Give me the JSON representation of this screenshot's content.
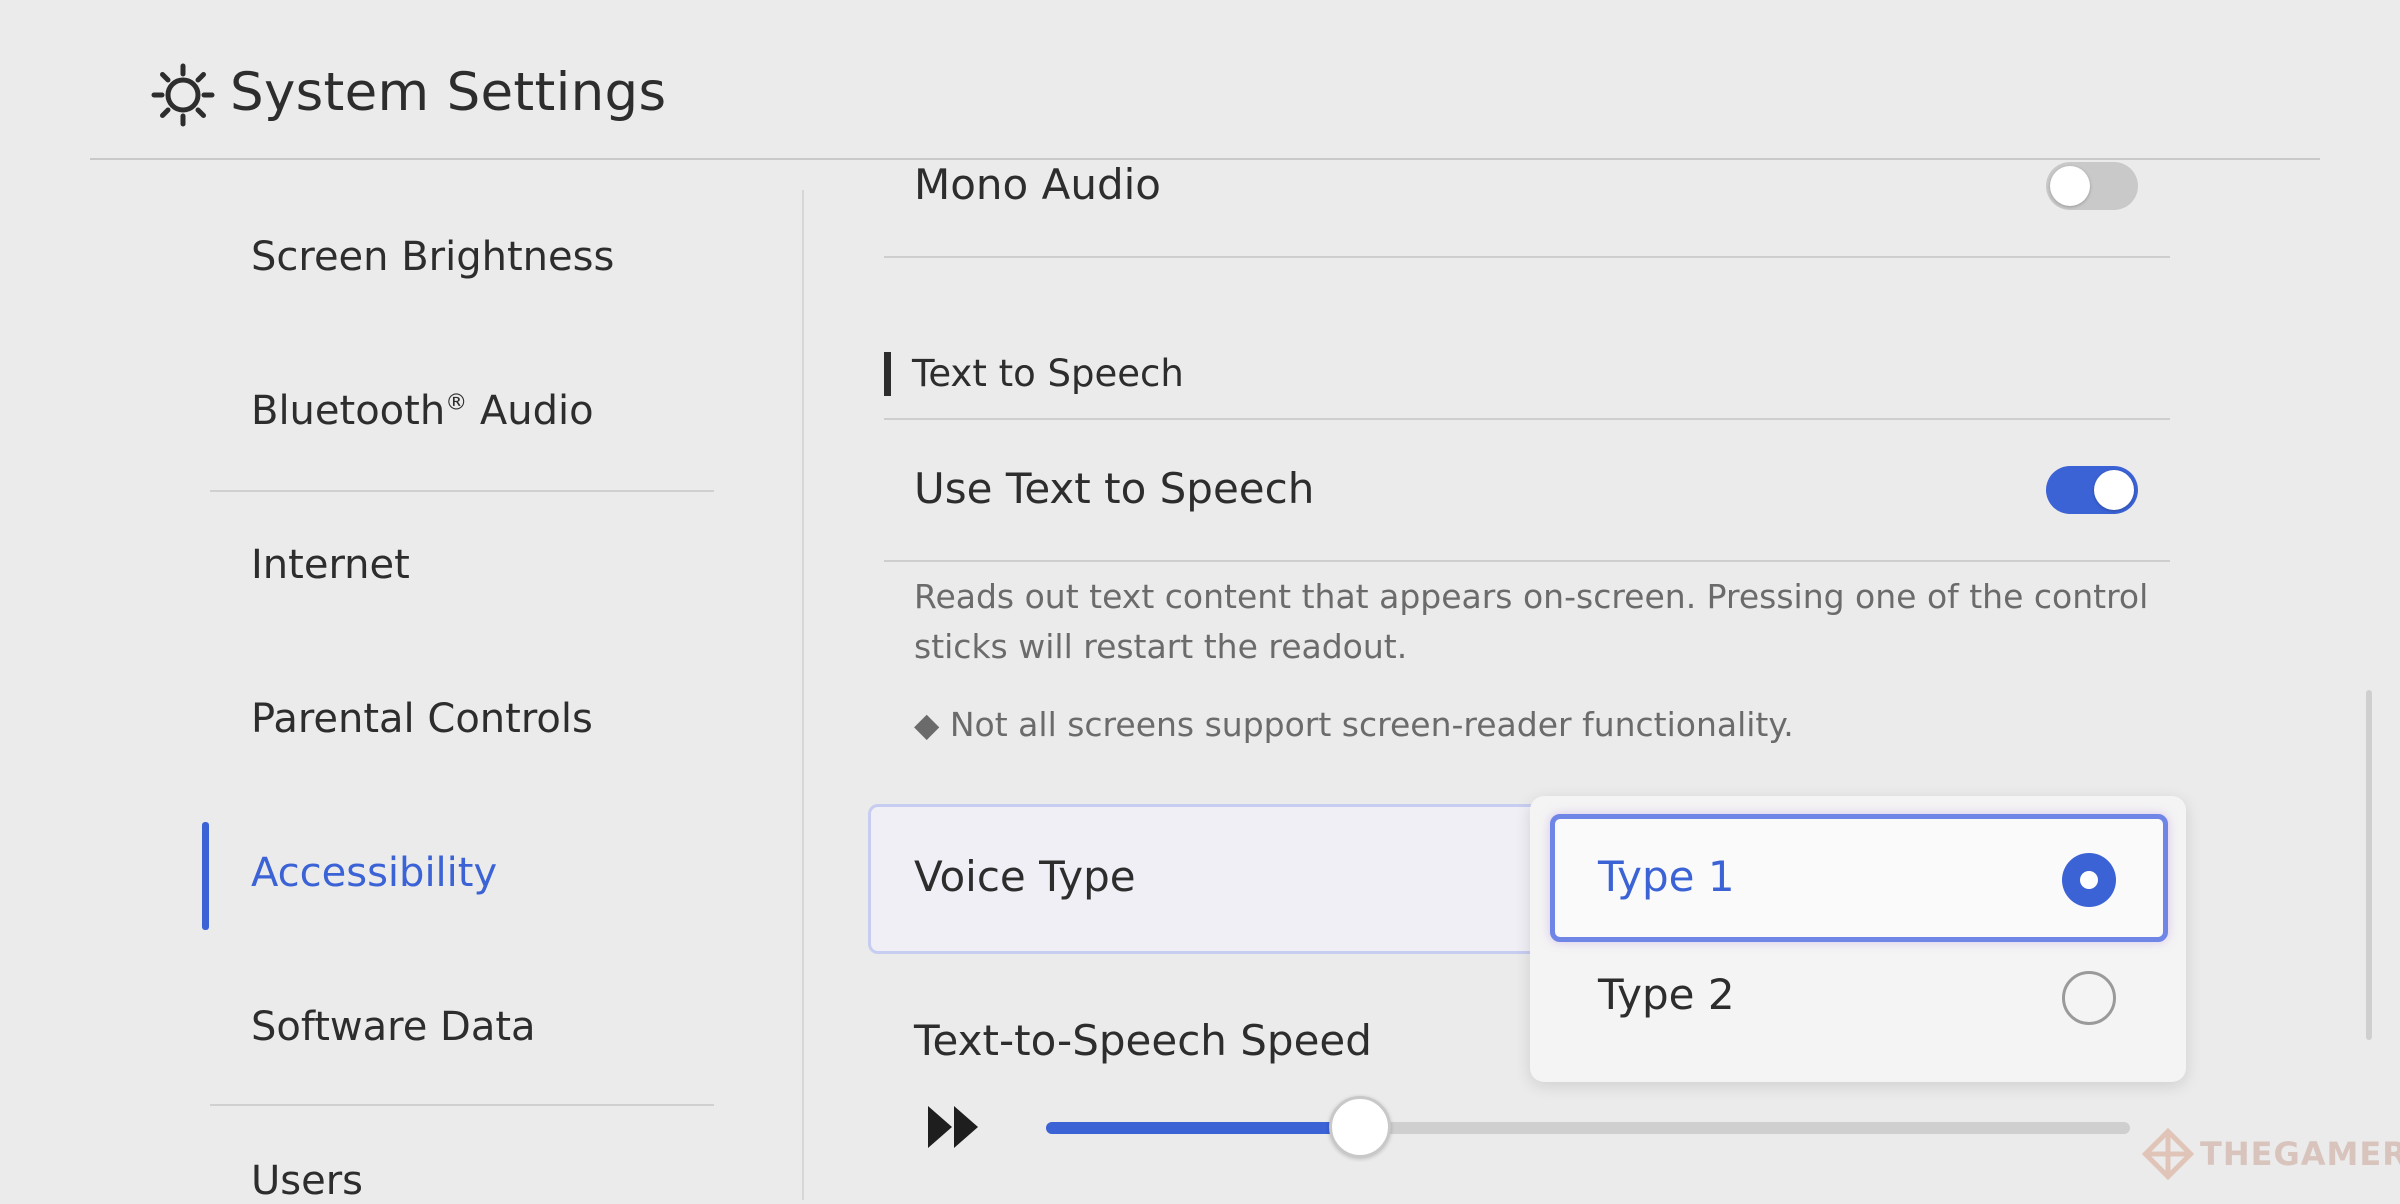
{
  "header": {
    "title": "System Settings",
    "icon": "gear-icon"
  },
  "sidebar": {
    "items": [
      {
        "label": "Screen Brightness"
      },
      {
        "label": "Bluetooth",
        "suffix": "Audio",
        "reg": "®"
      },
      {
        "label": "Internet"
      },
      {
        "label": "Parental Controls"
      },
      {
        "label": "Accessibility",
        "active": true
      },
      {
        "label": "Software Data"
      },
      {
        "label": "Users"
      }
    ]
  },
  "main": {
    "mono_audio": {
      "label": "Mono Audio",
      "enabled": false
    },
    "tts_section": {
      "title": "Text to Speech"
    },
    "use_tts": {
      "label": "Use Text to Speech",
      "enabled": true,
      "description": "Reads out text content that appears on-screen. Pressing one of the control sticks will restart the readout.",
      "note": "◆ Not all screens support screen-reader functionality."
    },
    "voice_type": {
      "label": "Voice Type",
      "options": [
        {
          "label": "Type 1",
          "selected": true
        },
        {
          "label": "Type 2",
          "selected": false
        }
      ]
    },
    "speed": {
      "label": "Text-to-Speech Speed",
      "value": 0.29
    }
  },
  "watermark": {
    "text": "THEGAMER"
  },
  "colors": {
    "accent": "#3b63d6",
    "background": "#ebebeb",
    "text": "#2d2d2d"
  }
}
